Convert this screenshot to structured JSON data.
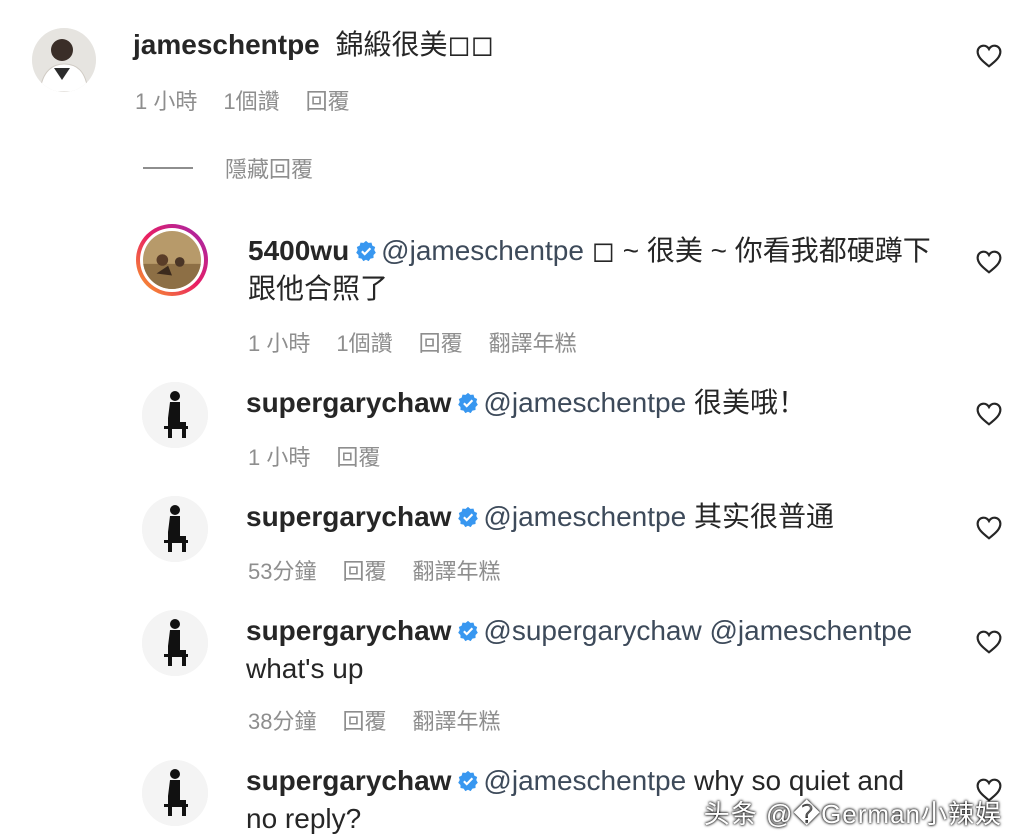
{
  "top_comment": {
    "username": "jameschentpe",
    "text": "錦緞很美◻◻",
    "time": "1 小時",
    "likes": "1個讚",
    "reply": "回覆"
  },
  "hide_replies": "隱藏回覆",
  "replies": [
    {
      "username": "5400wu",
      "mention": "@jameschentpe",
      "text_line1": "◻ ~ 很美 ~ 你看我都硬蹲下",
      "text_line2": "跟他合照了",
      "time": "1 小時",
      "likes": "1個讚",
      "reply": "回覆",
      "translate": "翻譯年糕"
    },
    {
      "username": "supergarychaw",
      "mention": "@jameschentpe",
      "text": "很美哦！",
      "time": "1 小時",
      "reply": "回覆"
    },
    {
      "username": "supergarychaw",
      "mention": "@jameschentpe",
      "text": "其实很普通",
      "time": "53分鐘",
      "reply": "回覆",
      "translate": "翻譯年糕"
    },
    {
      "username": "supergarychaw",
      "mention": "@supergarychaw @jameschentpe",
      "text_line2": "what's up",
      "time": "38分鐘",
      "reply": "回覆",
      "translate": "翻譯年糕"
    },
    {
      "username": "supergarychaw",
      "mention": "@jameschentpe",
      "text": "why so quiet and",
      "text_line2": "no reply?"
    }
  ],
  "watermark": "头条 @�German小辣娱",
  "colors": {
    "verified": "#3897f0",
    "meta_gray": "#8e8e8e",
    "text": "#262626"
  },
  "icons": [
    "heart-icon",
    "verified-badge-icon",
    "avatar"
  ]
}
